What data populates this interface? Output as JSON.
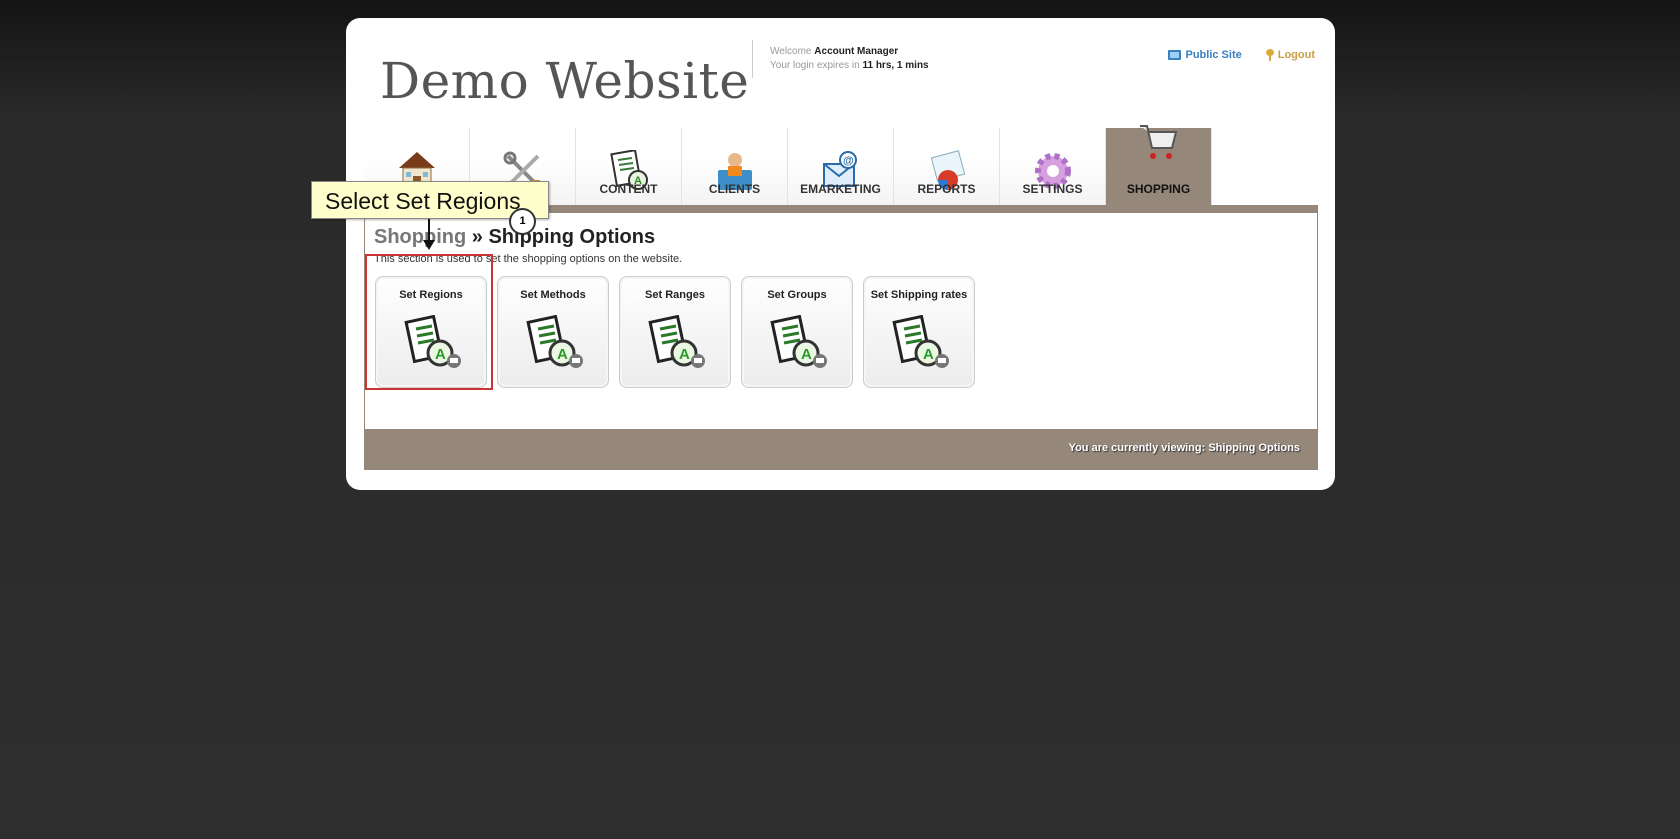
{
  "header": {
    "site_title": "Demo Website",
    "welcome_prefix": "Welcome",
    "user_name": "Account Manager",
    "expires_prefix": "Your login expires in",
    "expires_value": "11 hrs, 1 mins",
    "public_site_label": "Public Site",
    "logout_label": "Logout"
  },
  "tabs": [
    {
      "label": "",
      "icon": "house-icon"
    },
    {
      "label": "",
      "icon": "tools-icon"
    },
    {
      "label": "CONTENT",
      "icon": "document-icon"
    },
    {
      "label": "CLIENTS",
      "icon": "person-folder-icon"
    },
    {
      "label": "EMARKETING",
      "icon": "email-icon"
    },
    {
      "label": "REPORTS",
      "icon": "report-chart-icon"
    },
    {
      "label": "SETTINGS",
      "icon": "gear-icon"
    },
    {
      "label": "SHOPPING",
      "icon": "shopping-cart-icon",
      "active": true
    }
  ],
  "main": {
    "breadcrumb_parent": "Shopping",
    "breadcrumb_sep": " » ",
    "breadcrumb_current": "Shipping Options",
    "description": "This section is used to set the shopping options on the website.",
    "cards": [
      {
        "label": "Set Regions"
      },
      {
        "label": "Set Methods"
      },
      {
        "label": "Set Ranges"
      },
      {
        "label": "Set Groups"
      },
      {
        "label": "Set Shipping rates"
      }
    ],
    "status_text": "You are currently viewing: Shipping Options"
  },
  "annotation": {
    "callout_text": "Select Set Regions",
    "step_number": "1"
  },
  "colors": {
    "accent_tab": "#95887a",
    "link_blue": "#3a7fc1",
    "logout_gold": "#c8a040",
    "highlight_red": "#cc3333",
    "callout_bg": "#ffffcc"
  }
}
